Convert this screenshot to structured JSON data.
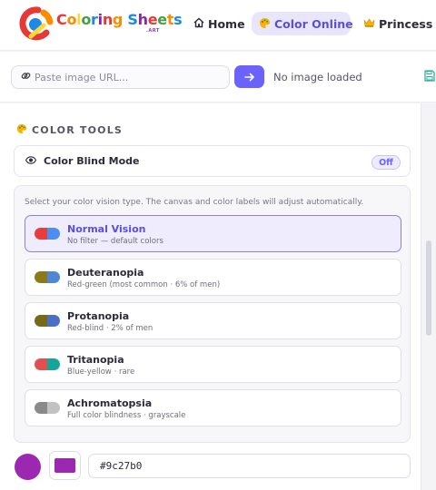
{
  "header": {
    "brand": {
      "letters": [
        {
          "ch": "C",
          "color": "#e53935"
        },
        {
          "ch": "o",
          "color": "#fb8c00"
        },
        {
          "ch": "l",
          "color": "#fdd835"
        },
        {
          "ch": "o",
          "color": "#43a047"
        },
        {
          "ch": "r",
          "color": "#1e88e5"
        },
        {
          "ch": "i",
          "color": "#8e24aa"
        },
        {
          "ch": "n",
          "color": "#e53935"
        },
        {
          "ch": "g",
          "color": "#fb8c00"
        },
        {
          "ch": " ",
          "color": "#000000"
        },
        {
          "ch": "S",
          "color": "#1e88e5"
        },
        {
          "ch": "h",
          "color": "#8e24aa"
        },
        {
          "ch": "e",
          "color": "#e53935"
        },
        {
          "ch": "e",
          "color": "#43a047"
        },
        {
          "ch": "t",
          "color": "#fb8c00"
        },
        {
          "ch": "s",
          "color": "#1e88e5"
        }
      ],
      "suffix": ".ART"
    },
    "nav": [
      {
        "label": "Home",
        "icon": "home-icon"
      },
      {
        "label": "Color Online",
        "icon": "palette-icon"
      },
      {
        "label": "Princess",
        "icon": "crown-icon"
      }
    ],
    "accent_color": "#6c63ff"
  },
  "urlbar": {
    "placeholder": "Paste image URL...",
    "status": "No image loaded",
    "go_icon": "arrow-right-icon",
    "save_icon": "save-icon"
  },
  "panel": {
    "section_title": "COLOR TOOLS",
    "color_blind_mode": {
      "label": "Color Blind Mode",
      "toggle": "Off"
    },
    "hint": "Select your color vision type. The canvas and color labels will adjust automatically.",
    "options": [
      {
        "name": "Normal Vision",
        "desc": "No filter — default colors",
        "colors": [
          "#e53e3e",
          "#4f8ef0"
        ],
        "selected": true
      },
      {
        "name": "Deuteranopia",
        "desc": "Red-green (most common · 6% of men)",
        "colors": [
          "#8a7a1a",
          "#4f86d6"
        ],
        "selected": false
      },
      {
        "name": "Protanopia",
        "desc": "Red-blind · 2% of men",
        "colors": [
          "#77691a",
          "#4a6fc4"
        ],
        "selected": false
      },
      {
        "name": "Tritanopia",
        "desc": "Blue-yellow · rare",
        "colors": [
          "#e05050",
          "#17a59a"
        ],
        "selected": false
      },
      {
        "name": "Achromatopsia",
        "desc": "Full color blindness · grayscale",
        "colors": [
          "#8a8a8a",
          "#c2c2c2"
        ],
        "selected": false
      }
    ]
  },
  "color": {
    "hex": "#9c27b0",
    "swatch": "#9c27b0"
  }
}
